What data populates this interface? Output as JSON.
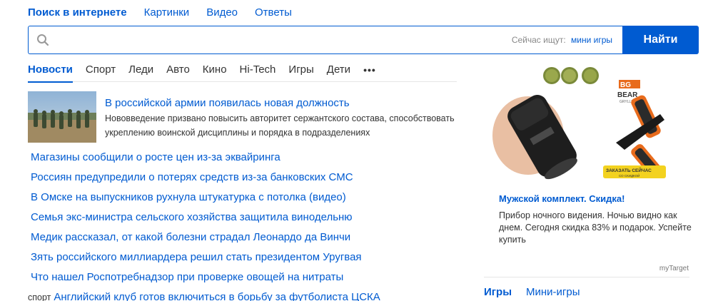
{
  "top_tabs": [
    {
      "label": "Поиск в интернете",
      "active": true
    },
    {
      "label": "Картинки",
      "active": false
    },
    {
      "label": "Видео",
      "active": false
    },
    {
      "label": "Ответы",
      "active": false
    }
  ],
  "search": {
    "value": "",
    "placeholder": "",
    "hint_label": "Сейчас ищут:",
    "hint_link": "мини игры",
    "button_label": "Найти",
    "icon": "search-icon"
  },
  "news_tabs": [
    {
      "label": "Новости",
      "active": true
    },
    {
      "label": "Спорт",
      "active": false
    },
    {
      "label": "Леди",
      "active": false
    },
    {
      "label": "Авто",
      "active": false
    },
    {
      "label": "Кино",
      "active": false
    },
    {
      "label": "Hi-Tech",
      "active": false
    },
    {
      "label": "Игры",
      "active": false
    },
    {
      "label": "Дети",
      "active": false
    },
    {
      "label": "•••",
      "active": false
    }
  ],
  "lead_news": {
    "title": "В российской армии появилась новая должность",
    "description": "Нововведение призвано повысить авторитет сержантского состава, способствовать укреплению воинской дисциплины и порядка в подразделениях"
  },
  "news_items": [
    {
      "rubric": "",
      "title": "Магазины сообщили о росте цен из-за эквайринга"
    },
    {
      "rubric": "",
      "title": "Россиян предупредили о потерях средств из-за банковских СМС"
    },
    {
      "rubric": "",
      "title": "В Омске на выпускников рухнула штукатурка с потолка (видео)"
    },
    {
      "rubric": "",
      "title": "Семья экс-министра сельского хозяйства защитила винодельню"
    },
    {
      "rubric": "",
      "title": "Медик рассказал, от какой болезни страдал Леонардо да Винчи"
    },
    {
      "rubric": "",
      "title": "Зять российского миллиардера решил стать президентом Уругвая"
    },
    {
      "rubric": "",
      "title": "Что нашел Роспотребнадзор при проверке овощей на нитраты"
    },
    {
      "rubric": "спорт",
      "title": "Английский клуб готов включиться в борьбу за футболиста ЦСКА"
    }
  ],
  "ad": {
    "title": "Мужской комплект. Скидка!",
    "text": "Прибор ночного видения. Ночью видно как днем. Сегодня скидка 83% и подарок. Успейте купить",
    "source": "myTarget",
    "brand_text": "BEAR",
    "brand_sub": "GRYLLS",
    "order_text": "ЗАКАЗАТЬ СЕЙЧАС",
    "order_sub": "СО СКИДКОЙ"
  },
  "games_tabs": [
    {
      "label": "Игры",
      "active": true
    },
    {
      "label": "Мини-игры",
      "active": false
    }
  ],
  "colors": {
    "accent": "#005bd1",
    "text": "#333333",
    "muted": "#888888"
  }
}
